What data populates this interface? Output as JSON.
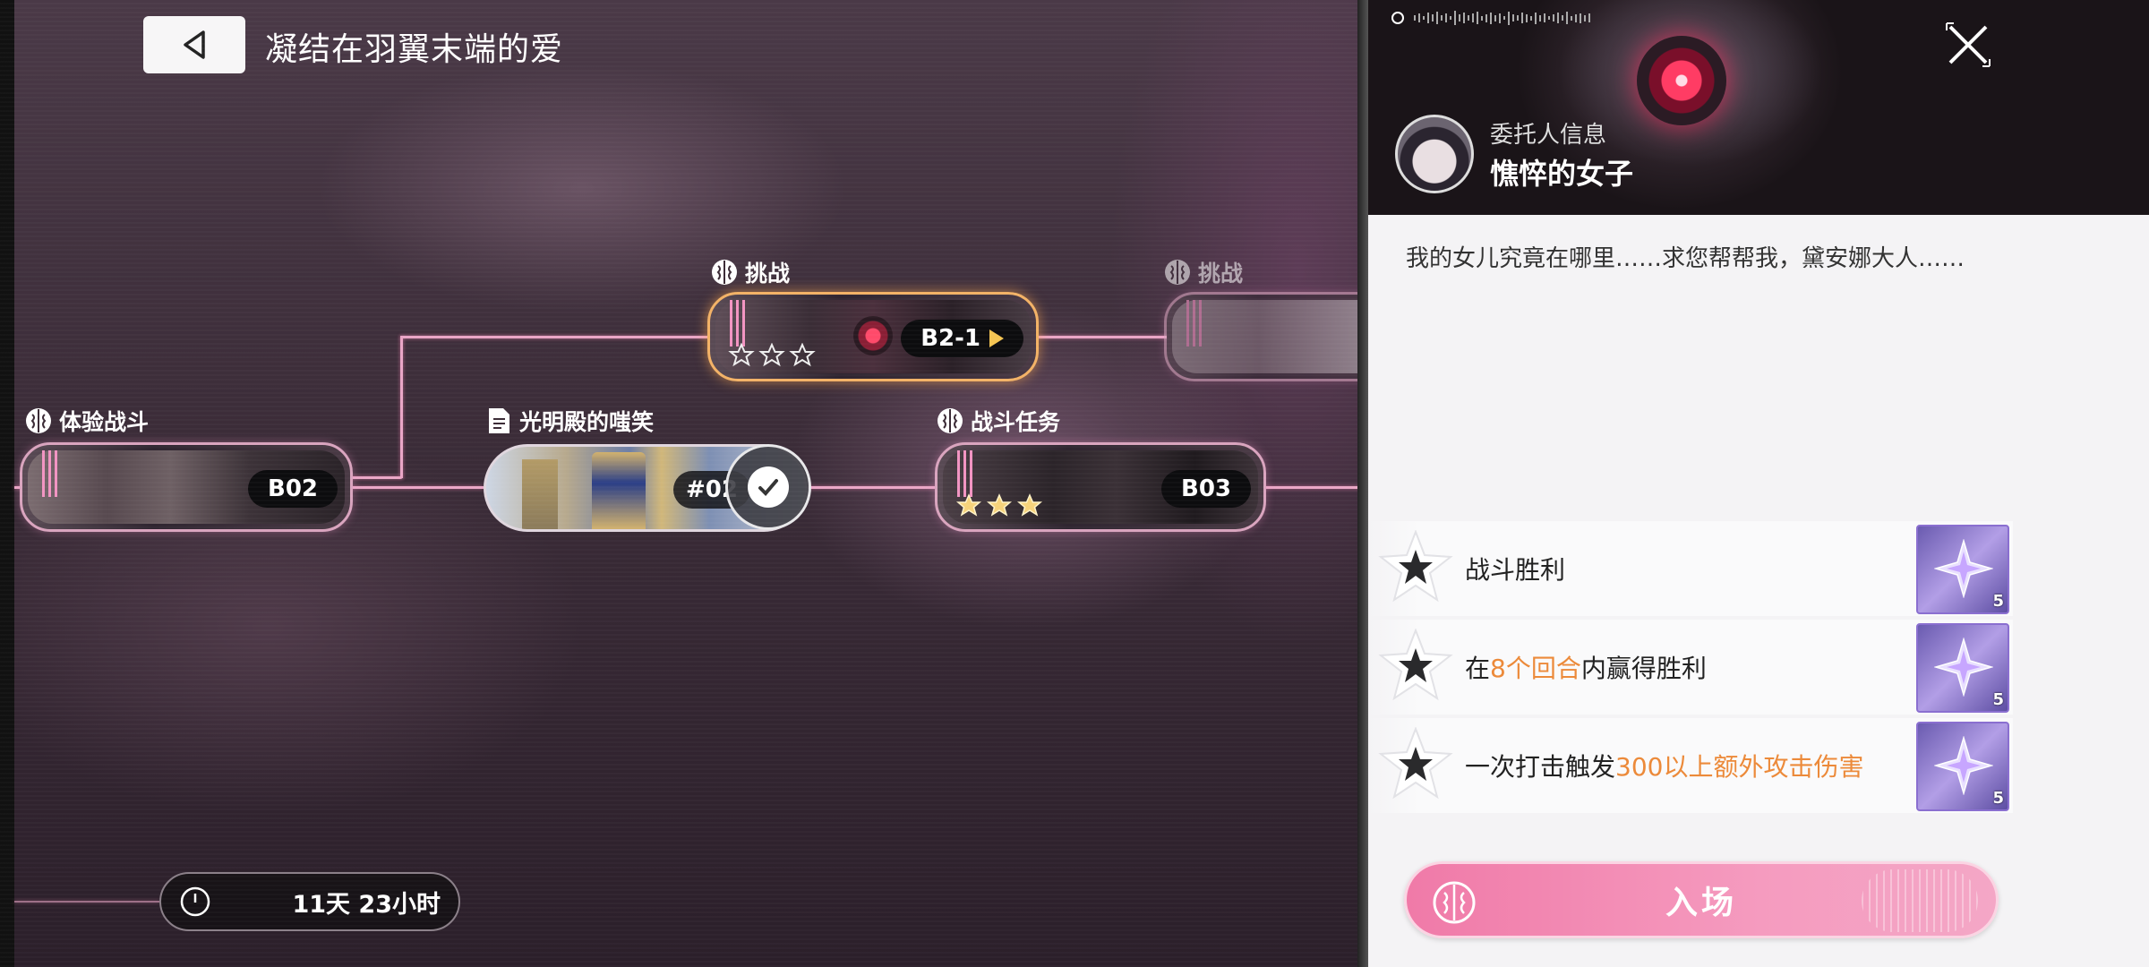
{
  "header": {
    "title": "凝结在羽翼末端的爱",
    "back_icon": "back-triangle-icon"
  },
  "map": {
    "nodes": [
      {
        "type_label": "体验战斗",
        "code": "B02",
        "stars_earned": 0,
        "stars_total": 0
      },
      {
        "type_label": "光明殿的嗤笑",
        "code": "#02",
        "cleared": true
      },
      {
        "type_label": "挑战",
        "code": "B2-1",
        "stars_earned": 0,
        "stars_total": 3,
        "selected": true
      },
      {
        "type_label": "战斗任务",
        "code": "B03",
        "stars_earned": 3,
        "stars_total": 3
      },
      {
        "type_label": "挑战",
        "code": "",
        "locked_preview": true
      }
    ],
    "timer": {
      "text": "11天 23小时",
      "icon": "clock-icon"
    }
  },
  "panel": {
    "client": {
      "caption": "委托人信息",
      "name": "憔悴的女子"
    },
    "quote": "我的女儿究竟在哪里……求您帮帮我，黛安娜大人……",
    "objectives": [
      {
        "parts": [
          {
            "text": "战斗胜利",
            "hl": false
          }
        ],
        "reward_qty": "5"
      },
      {
        "parts": [
          {
            "text": "在",
            "hl": false
          },
          {
            "text": "8个回合",
            "hl": true
          },
          {
            "text": "内赢得胜利",
            "hl": false
          }
        ],
        "reward_qty": "5"
      },
      {
        "parts": [
          {
            "text": "一次打击触发",
            "hl": false
          },
          {
            "text": "300以上额外攻击伤害",
            "hl": true
          }
        ],
        "reward_qty": "5"
      }
    ],
    "enter_label": "入场"
  },
  "colors": {
    "accent_pink": "#f07aa8",
    "highlight_orange": "#ec8a3a",
    "selected_border": "#f3b266",
    "path_line": "#e9a6c6"
  }
}
